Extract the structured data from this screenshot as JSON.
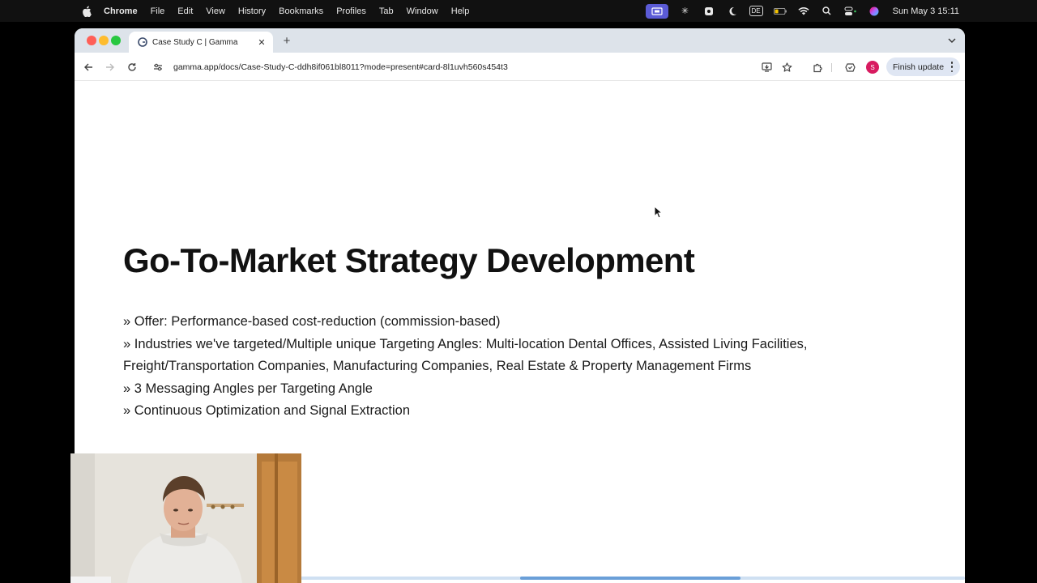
{
  "menubar": {
    "app_name": "Chrome",
    "items": [
      "File",
      "Edit",
      "View",
      "History",
      "Bookmarks",
      "Profiles",
      "Tab",
      "Window",
      "Help"
    ],
    "keyboard_layout": "DE",
    "clock": "Sun May 3  15:11"
  },
  "browser": {
    "tab": {
      "title": "Case Study C | Gamma"
    },
    "url": "gamma.app/docs/Case-Study-C-ddh8if061bl8011?mode=present#card-8l1uvh560s454t3",
    "avatar_initial": "S",
    "finish_update_label": "Finish update"
  },
  "slide": {
    "title": "Go-To-Market Strategy Development",
    "bullets": [
      "» Offer: Performance-based cost-reduction (commission-based)",
      "» Industries we've targeted/Multiple unique Targeting Angles: Multi-location Dental Offices, Assisted Living Facilities, Freight/Transportation Companies, Manufacturing Companies, Real Estate & Property Management Firms",
      "» 3 Messaging Angles per Targeting Angle",
      "» Continuous Optimization and Signal Extraction"
    ]
  },
  "colors": {
    "accent_screen_share": "#5b5bd6",
    "avatar": "#d81b60",
    "scroll_thumb": "#6a9fd8"
  }
}
